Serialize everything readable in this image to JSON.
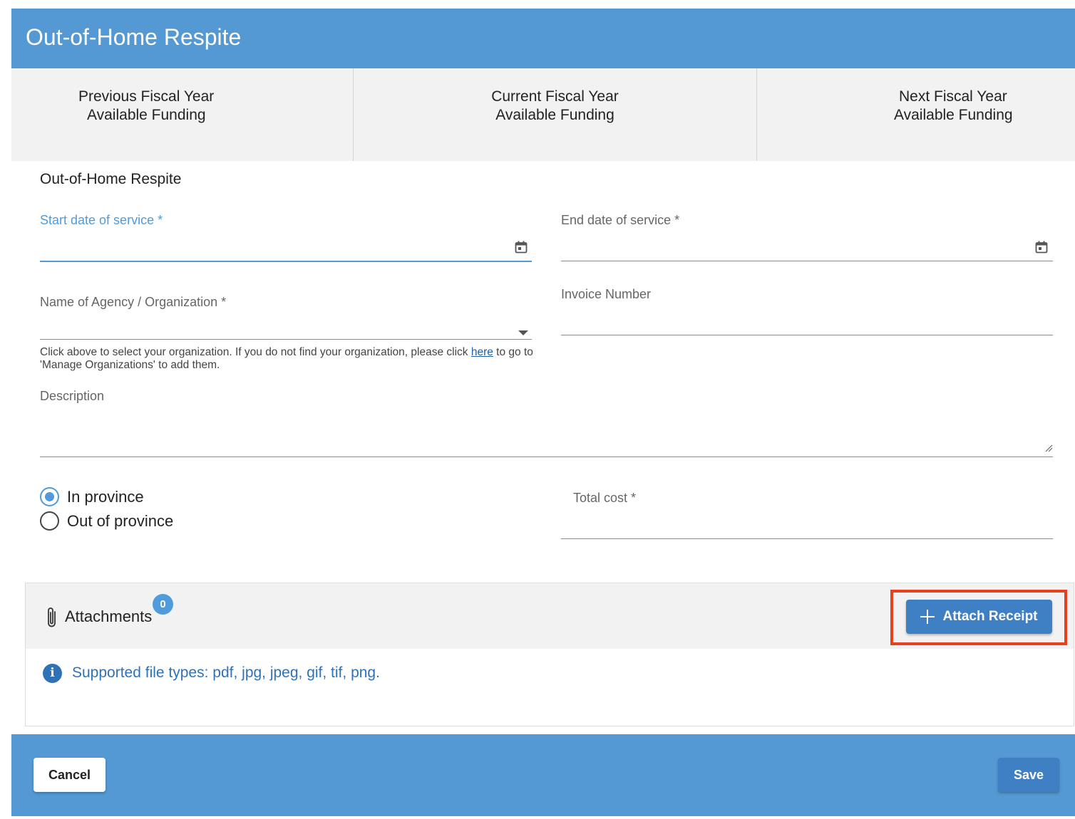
{
  "header": {
    "title": "Out-of-Home Respite"
  },
  "funding": [
    {
      "line1": "Previous Fiscal Year",
      "line2": "Available Funding"
    },
    {
      "line1": "Current Fiscal Year",
      "line2": "Available Funding"
    },
    {
      "line1": "Next Fiscal Year",
      "line2": "Available Funding"
    }
  ],
  "form": {
    "section_title": "Out-of-Home Respite",
    "start_date": {
      "label": "Start date of service *",
      "value": "",
      "icon": "calendar-icon"
    },
    "end_date": {
      "label": "End date of service *",
      "value": "",
      "icon": "calendar-icon"
    },
    "agency": {
      "label": "Name of Agency / Organization *",
      "value": "",
      "icon": "chevron-down-icon"
    },
    "invoice": {
      "label": "Invoice Number",
      "value": ""
    },
    "helper": {
      "text_before": "Click above to select your organization. If you do not find your organization, please click ",
      "link_text": "here",
      "text_after": " to go to 'Manage Organizations' to add them."
    },
    "description": {
      "label": "Description",
      "value": ""
    },
    "location_options": [
      {
        "label": "In province",
        "checked": true
      },
      {
        "label": "Out of province",
        "checked": false
      }
    ],
    "total_cost": {
      "label": "Total cost *",
      "value": ""
    }
  },
  "attachments": {
    "label": "Attachments",
    "count": "0",
    "attach_button": "Attach Receipt",
    "supported_text": "Supported file types: pdf, jpg, jpeg, gif, tif, png."
  },
  "footer": {
    "cancel_label": "Cancel",
    "save_label": "Save"
  },
  "colors": {
    "header_bg": "#5499d3",
    "accent": "#4f9bdb",
    "button_primary": "#3f7fc4",
    "highlight": "#e8401f",
    "link": "#1b5fa8"
  }
}
